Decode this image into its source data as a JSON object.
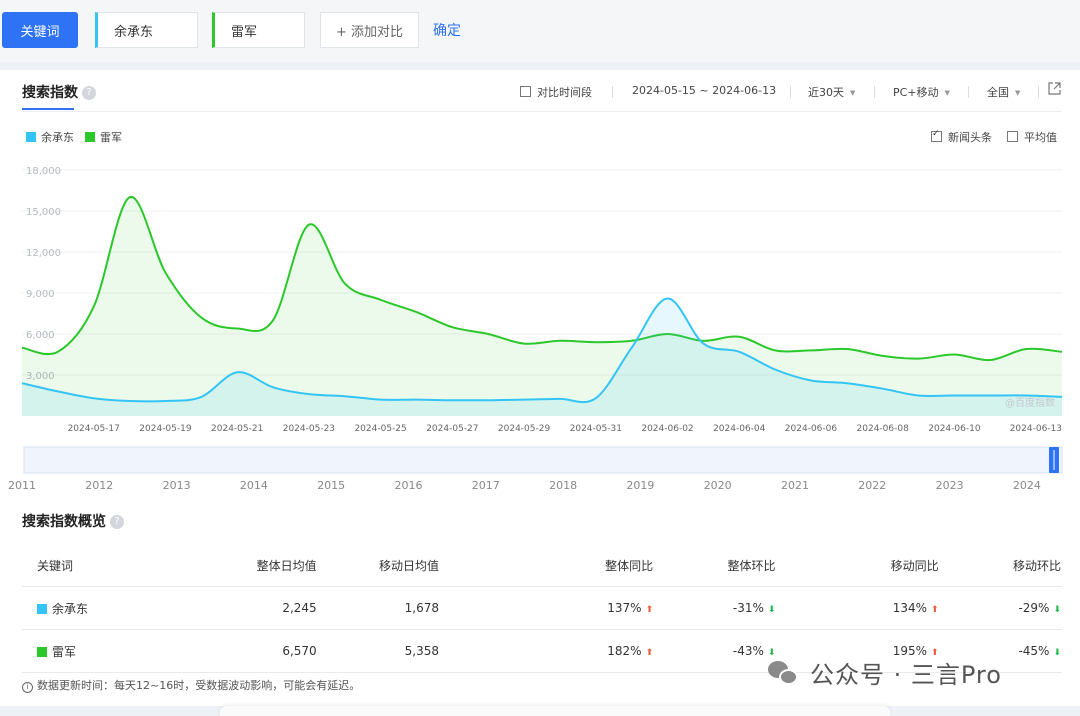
{
  "toolbar": {
    "keyword_button": "关键词",
    "keywords": [
      "余承东",
      "雷军"
    ],
    "add_compare": "+ 添加对比",
    "confirm": "确定"
  },
  "panel": {
    "tab_title": "搜索指数",
    "help": "?",
    "compare_period": "对比时间段",
    "date_range": "2024-05-15 ~ 2024-06-13",
    "period": "近30天",
    "device": "PC+移动",
    "region": "全国",
    "export_icon": "external-link-icon",
    "news_headline": "新闻头条",
    "average": "平均值",
    "watermark": "@百度指数"
  },
  "colors": {
    "accent": "#2e72f5",
    "series1": "#33c4f5",
    "series2": "#2bc82b",
    "up": "#f05a3c",
    "down": "#1fb84a"
  },
  "chart_data": {
    "type": "area",
    "y_ticks": [
      "3,000",
      "6,000",
      "9,000",
      "12,000",
      "15,000",
      "18,000"
    ],
    "ylim": [
      0,
      18000
    ],
    "x_tick_labels": [
      "2024-05-17",
      "2024-05-19",
      "2024-05-21",
      "2024-05-23",
      "2024-05-25",
      "2024-05-27",
      "2024-05-29",
      "2024-05-31",
      "2024-06-02",
      "2024-06-04",
      "2024-06-06",
      "2024-06-08",
      "2024-06-10",
      "2024-06-13"
    ],
    "dates": [
      "2024-05-15",
      "2024-05-16",
      "2024-05-17",
      "2024-05-18",
      "2024-05-19",
      "2024-05-20",
      "2024-05-21",
      "2024-05-22",
      "2024-05-23",
      "2024-05-24",
      "2024-05-25",
      "2024-05-26",
      "2024-05-27",
      "2024-05-28",
      "2024-05-29",
      "2024-05-30",
      "2024-05-31",
      "2024-06-01",
      "2024-06-02",
      "2024-06-03",
      "2024-06-04",
      "2024-06-05",
      "2024-06-06",
      "2024-06-07",
      "2024-06-08",
      "2024-06-09",
      "2024-06-10",
      "2024-06-11",
      "2024-06-12",
      "2024-06-13"
    ],
    "series": [
      {
        "name": "余承东",
        "values": [
          2400,
          1800,
          1300,
          1100,
          1100,
          1400,
          3200,
          2100,
          1600,
          1450,
          1200,
          1200,
          1150,
          1150,
          1200,
          1250,
          1300,
          5000,
          8600,
          5300,
          4700,
          3400,
          2600,
          2400,
          2000,
          1500,
          1500,
          1500,
          1500,
          1400
        ]
      },
      {
        "name": "雷军",
        "values": [
          5000,
          4700,
          8000,
          16000,
          10500,
          7200,
          6400,
          7000,
          14000,
          9700,
          8500,
          7600,
          6500,
          6000,
          5300,
          5500,
          5400,
          5500,
          6000,
          5500,
          5800,
          4800,
          4800,
          4900,
          4400,
          4200,
          4500,
          4100,
          4900,
          4700
        ]
      }
    ]
  },
  "timeline_years": [
    "2011",
    "2012",
    "2013",
    "2014",
    "2015",
    "2016",
    "2017",
    "2018",
    "2019",
    "2020",
    "2021",
    "2022",
    "2023",
    "2024"
  ],
  "summary": {
    "title": "搜索指数概览",
    "headers": [
      "关键词",
      "整体日均值",
      "移动日均值",
      "整体同比",
      "整体环比",
      "移动同比",
      "移动环比"
    ],
    "rows": [
      {
        "keyword": "余承东",
        "overall_avg": "2,245",
        "mobile_avg": "1,678",
        "overall_yoy": "137%",
        "overall_mom": "-31%",
        "mobile_yoy": "134%",
        "mobile_mom": "-29%"
      },
      {
        "keyword": "雷军",
        "overall_avg": "6,570",
        "mobile_avg": "5,358",
        "overall_yoy": "182%",
        "overall_mom": "-43%",
        "mobile_yoy": "195%",
        "mobile_mom": "-45%"
      }
    ]
  },
  "footer": {
    "note": "数据更新时间：每天12~16时，受数据波动影响，可能会有延迟。",
    "brand": "公众号 · 三言Pro"
  }
}
